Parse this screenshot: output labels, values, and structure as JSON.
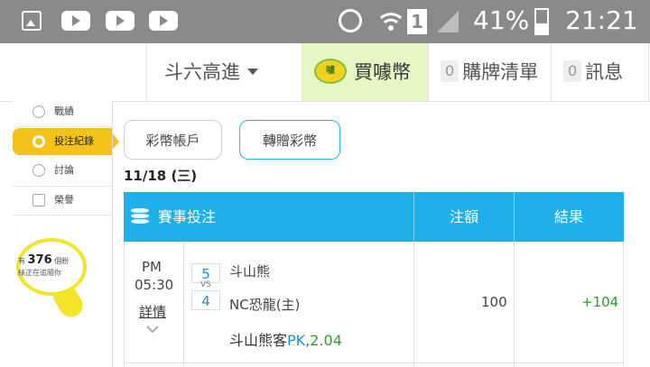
{
  "status_bar": {
    "battery": "41%",
    "time": "21:21",
    "sim": "1"
  },
  "nav": {
    "user_name": "斗六高進",
    "buy_coins": "買噱幣",
    "cart_count": "0",
    "cart_label": "購牌清單",
    "msg_count": "0",
    "msg_label": "訊息"
  },
  "sidebar": {
    "items": [
      {
        "label": "戰績",
        "icon": "trophy-icon"
      },
      {
        "label": "投注紀錄",
        "icon": "bet-record-icon",
        "active": true
      },
      {
        "label": "討論",
        "icon": "discussion-icon"
      },
      {
        "label": "榮譽",
        "icon": "honor-icon"
      }
    ],
    "fans": {
      "prefix": "有",
      "count": "376",
      "unit": "個粉",
      "suffix": "絲正在追隨你"
    }
  },
  "tabs": {
    "coin_account": "彩幣帳戶",
    "transfer_coins": "轉贈彩幣"
  },
  "date": "11/18 (三)",
  "table": {
    "headers": {
      "event": "賽事投注",
      "amount": "注額",
      "result": "結果"
    },
    "rows": [
      {
        "period": "PM",
        "time": "05:30",
        "details": "詳情",
        "away_score": "5",
        "vs": "VS",
        "home_score": "4",
        "away_team": "斗山熊",
        "home_team": "NC恐龍(主)",
        "pick_team": "斗山熊客",
        "pick_type": "PK",
        "pick_odds": ",2.04",
        "amount": "100",
        "result": "+104"
      }
    ]
  },
  "colors": {
    "accent_blue": "#1fb0ea",
    "sidebar_active": "#f4c21a",
    "win_green": "#2a9d2a",
    "buy_bg": "#e6f7c4"
  }
}
